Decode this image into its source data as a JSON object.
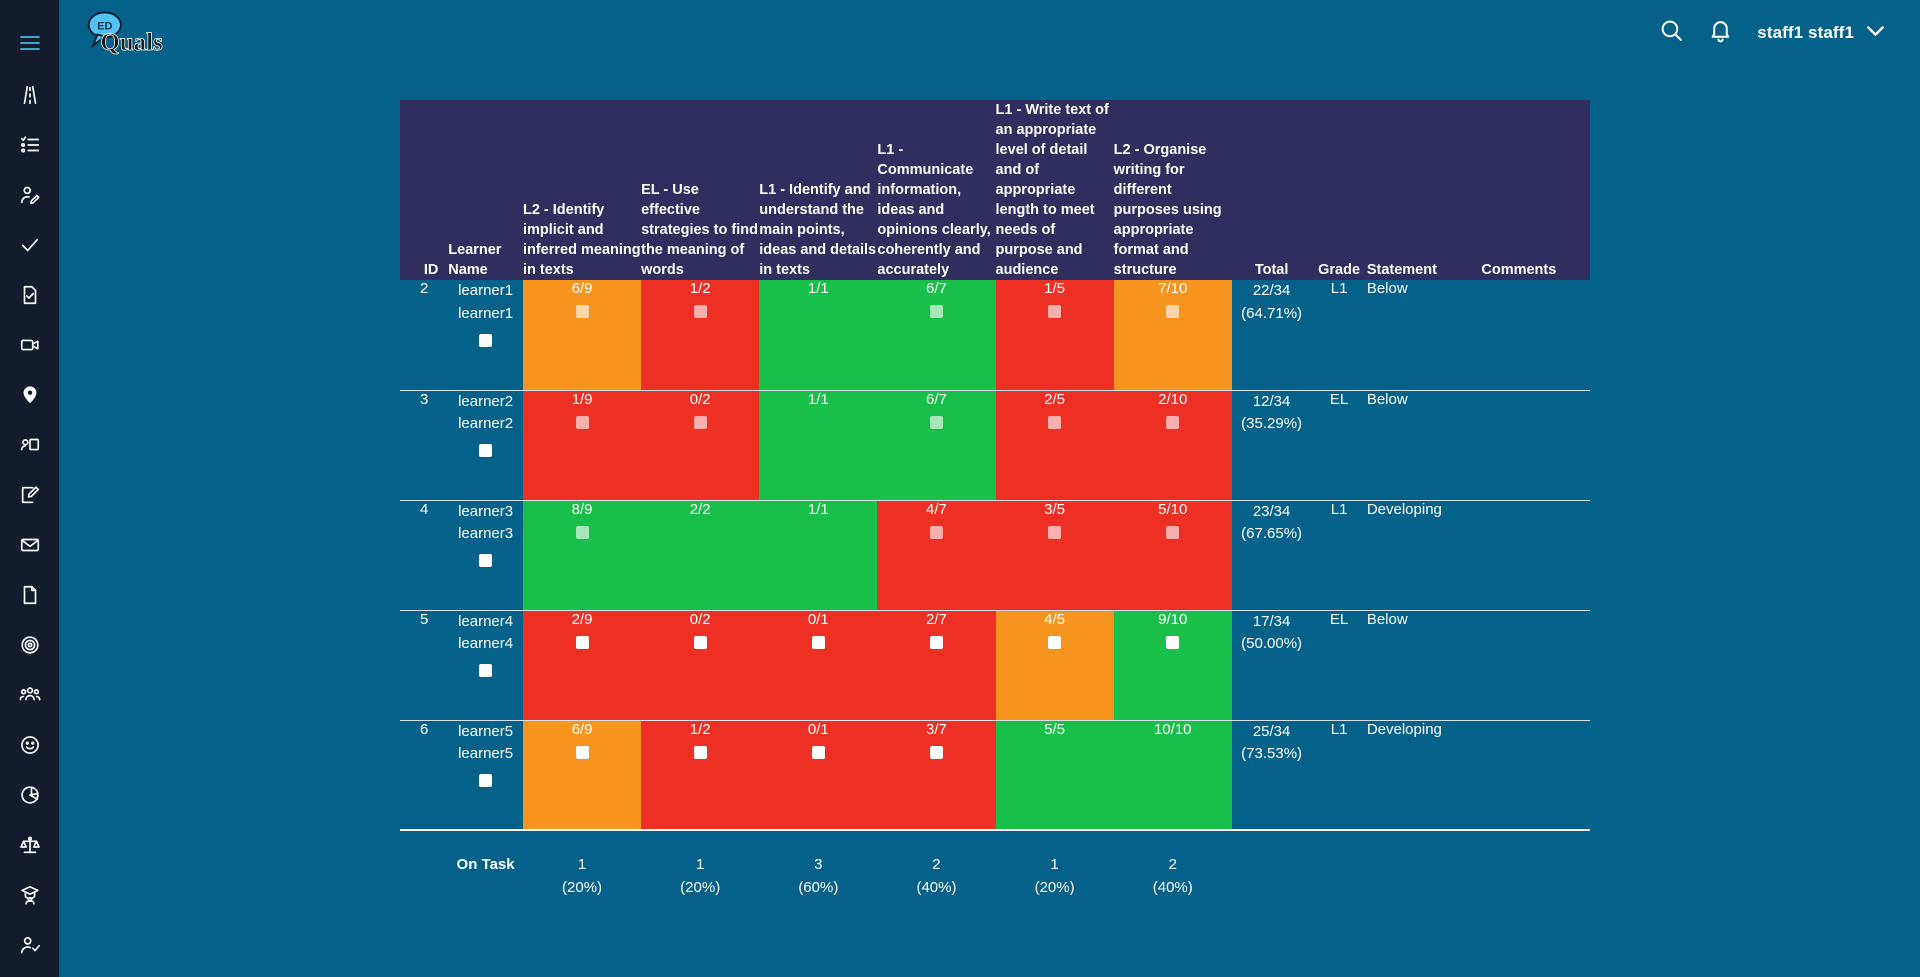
{
  "app": {
    "logo_text_top": "ED",
    "logo_text_main": "Quals"
  },
  "topbar": {
    "search_icon": "search-icon",
    "bell_icon": "bell-icon",
    "username": "staff1 staff1",
    "chevron": "chevron-down-icon"
  },
  "sidebar": {
    "items": [
      {
        "name": "hamburger-menu-icon",
        "label": "Menu"
      },
      {
        "name": "road-icon",
        "label": "Journey"
      },
      {
        "name": "checklist-icon",
        "label": "Tasks"
      },
      {
        "name": "user-edit-icon",
        "label": "Edit Learner"
      },
      {
        "name": "check-icon",
        "label": "Approvals"
      },
      {
        "name": "document-check-icon",
        "label": "Assessments"
      },
      {
        "name": "video-camera-icon",
        "label": "Sessions"
      },
      {
        "name": "location-pin-icon",
        "label": "Locations"
      },
      {
        "name": "user-screen-icon",
        "label": "Presentations"
      },
      {
        "name": "pencil-square-icon",
        "label": "Reviews"
      },
      {
        "name": "envelope-icon",
        "label": "Messages"
      },
      {
        "name": "file-icon",
        "label": "Files"
      },
      {
        "name": "target-icon",
        "label": "Targets"
      },
      {
        "name": "users-group-icon",
        "label": "Groups"
      },
      {
        "name": "smiley-face-icon",
        "label": "Wellbeing"
      },
      {
        "name": "pie-chart-icon",
        "label": "Reports"
      },
      {
        "name": "scales-icon",
        "label": "Compliance"
      },
      {
        "name": "graduation-user-icon",
        "label": "Learners"
      },
      {
        "name": "user-check-icon",
        "label": "Attendance"
      }
    ]
  },
  "table": {
    "columns": [
      {
        "key": "id",
        "label": "ID"
      },
      {
        "key": "name",
        "label": "Learner Name"
      },
      {
        "key": "c1",
        "label": "L2 - Identify implicit and inferred meaning in texts"
      },
      {
        "key": "c2",
        "label": "EL - Use effective strategies to find the meaning of words"
      },
      {
        "key": "c3",
        "label": "L1 - Identify and understand the main points, ideas and details in texts"
      },
      {
        "key": "c4",
        "label": "L1 - Communicate information, ideas and opinions clearly, coherently and accurately"
      },
      {
        "key": "c5",
        "label": "L1 - Write text of an appropriate level of detail and of appropriate length to meet needs of purpose and audience"
      },
      {
        "key": "c6",
        "label": "L2 - Organise writing for different purposes using appropriate format and structure"
      },
      {
        "key": "total",
        "label": "Total"
      },
      {
        "key": "grade",
        "label": "Grade"
      },
      {
        "key": "statement",
        "label": "Statement"
      },
      {
        "key": "comments",
        "label": "Comments"
      }
    ],
    "rows": [
      {
        "id": "2",
        "name_line1": "learner1",
        "name_line2": "learner1",
        "name_checkbox": "off",
        "cells": [
          {
            "value": "6/9",
            "color": "orange",
            "span": 1,
            "checkbox": "on"
          },
          {
            "value": "1/2",
            "color": "red",
            "span": 1,
            "checkbox": "on"
          },
          {
            "value": "1/1",
            "color": "green",
            "span": 1,
            "checkbox": "none"
          },
          {
            "value": "6/7",
            "color": "green",
            "span": 1,
            "checkbox": "on"
          },
          {
            "value": "1/5",
            "color": "red",
            "span": 1,
            "checkbox": "on"
          },
          {
            "value": "7/10",
            "color": "orange",
            "span": 1,
            "checkbox": "on"
          }
        ],
        "total": "22/34",
        "total_pct": "(64.71%)",
        "grade": "L1",
        "statement": "Below",
        "comments": ""
      },
      {
        "id": "3",
        "name_line1": "learner2",
        "name_line2": "learner2",
        "name_checkbox": "off",
        "cells": [
          {
            "value": "1/9",
            "color": "red",
            "span": 1,
            "checkbox": "on"
          },
          {
            "value": "0/2",
            "color": "red",
            "span": 1,
            "checkbox": "on"
          },
          {
            "value": "1/1",
            "color": "green",
            "span": 1,
            "checkbox": "none"
          },
          {
            "value": "6/7",
            "color": "green",
            "span": 1,
            "checkbox": "on"
          },
          {
            "value": "2/5",
            "color": "red",
            "span": 1,
            "checkbox": "on"
          },
          {
            "value": "2/10",
            "color": "red",
            "span": 1,
            "checkbox": "on"
          }
        ],
        "total": "12/34",
        "total_pct": "(35.29%)",
        "grade": "EL",
        "statement": "Below",
        "comments": ""
      },
      {
        "id": "4",
        "name_line1": "learner3",
        "name_line2": "learner3",
        "name_checkbox": "off",
        "cells": [
          {
            "value": "8/9",
            "color": "green",
            "span": 1,
            "checkbox": "on"
          },
          {
            "value": "2/2",
            "color": "green",
            "span": 1,
            "checkbox": "none"
          },
          {
            "value": "1/1",
            "color": "green",
            "span": 1,
            "checkbox": "none"
          },
          {
            "value": "4/7",
            "color": "red",
            "span": 1,
            "checkbox": "on"
          },
          {
            "value": "3/5",
            "color": "red",
            "span": 1,
            "checkbox": "on"
          },
          {
            "value": "5/10",
            "color": "red",
            "span": 1,
            "checkbox": "on"
          }
        ],
        "total": "23/34",
        "total_pct": "(67.65%)",
        "grade": "L1",
        "statement": "Developing",
        "comments": ""
      },
      {
        "id": "5",
        "name_line1": "learner4",
        "name_line2": "learner4",
        "name_checkbox": "off",
        "cells": [
          {
            "value": "2/9",
            "color": "red",
            "span": 1,
            "checkbox": "off"
          },
          {
            "value": "0/2",
            "color": "red",
            "span": 1,
            "checkbox": "off"
          },
          {
            "value": "0/1",
            "color": "red",
            "span": 1,
            "checkbox": "off"
          },
          {
            "value": "2/7",
            "color": "red",
            "span": 1,
            "checkbox": "off"
          },
          {
            "value": "4/5",
            "color": "orange",
            "span": 1,
            "checkbox": "off"
          },
          {
            "value": "9/10",
            "color": "green",
            "span": 1,
            "checkbox": "off"
          }
        ],
        "total": "17/34",
        "total_pct": "(50.00%)",
        "grade": "EL",
        "statement": "Below",
        "comments": ""
      },
      {
        "id": "6",
        "name_line1": "learner5",
        "name_line2": "learner5",
        "name_checkbox": "off",
        "cells": [
          {
            "value": "6/9",
            "color": "orange",
            "span": 1,
            "checkbox": "off"
          },
          {
            "value": "1/2",
            "color": "red",
            "span": 1,
            "checkbox": "off"
          },
          {
            "value": "0/1",
            "color": "red",
            "span": 1,
            "checkbox": "off"
          },
          {
            "value": "3/7",
            "color": "red",
            "span": 1,
            "checkbox": "off"
          },
          {
            "value": "5/5",
            "color": "green",
            "span": 1,
            "checkbox": "none"
          },
          {
            "value": "10/10",
            "color": "green",
            "span": 1,
            "checkbox": "none"
          }
        ],
        "total": "25/34",
        "total_pct": "(73.53%)",
        "grade": "L1",
        "statement": "Developing",
        "comments": ""
      }
    ],
    "summary": {
      "label": "On Task",
      "values": [
        {
          "count": "1",
          "pct": "(20%)"
        },
        {
          "count": "1",
          "pct": "(20%)"
        },
        {
          "count": "3",
          "pct": "(60%)"
        },
        {
          "count": "2",
          "pct": "(40%)"
        },
        {
          "count": "1",
          "pct": "(20%)"
        },
        {
          "count": "2",
          "pct": "(40%)"
        }
      ]
    }
  },
  "colors": {
    "page_bg": "#046189",
    "sidebar_bg": "#121c2d",
    "header_bg": "#2f2e5f",
    "red": "#ee2f24",
    "orange": "#f7941e",
    "green": "#18c04a"
  }
}
